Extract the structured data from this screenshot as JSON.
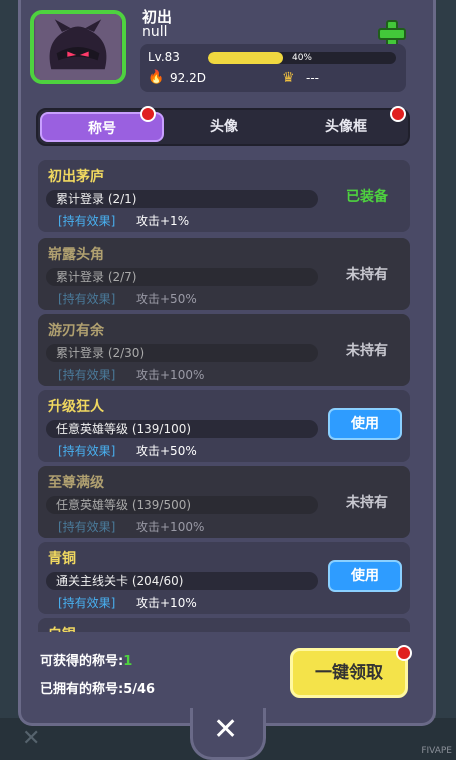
{
  "profile": {
    "name": "初出",
    "uid": "null",
    "level": "Lv.83",
    "exp_percent": 0.4,
    "exp_text": "40%",
    "power": "92.2D",
    "crown_value": "---"
  },
  "tabs": [
    {
      "label": "称号",
      "active": true,
      "badge": true
    },
    {
      "label": "头像",
      "active": false,
      "badge": false
    },
    {
      "label": "头像框",
      "active": false,
      "badge": true
    }
  ],
  "effect_label": "[持有效果]",
  "titles": [
    {
      "title": "初出茅庐",
      "requirement": "累计登录 (2/1)",
      "effect": "攻击+1%",
      "status": "已装备",
      "state": "equipped"
    },
    {
      "title": "崭露头角",
      "requirement": "累计登录 (2/7)",
      "effect": "攻击+50%",
      "status": "未持有",
      "state": "unowned"
    },
    {
      "title": "游刃有余",
      "requirement": "累计登录 (2/30)",
      "effect": "攻击+100%",
      "status": "未持有",
      "state": "unowned"
    },
    {
      "title": "升级狂人",
      "requirement": "任意英雄等级 (139/100)",
      "effect": "攻击+50%",
      "status": "使用",
      "state": "usable"
    },
    {
      "title": "至尊满级",
      "requirement": "任意英雄等级 (139/500)",
      "effect": "攻击+100%",
      "status": "未持有",
      "state": "unowned"
    },
    {
      "title": "青铜",
      "requirement": "通关主线关卡 (204/60)",
      "effect": "攻击+10%",
      "status": "使用",
      "state": "usable"
    },
    {
      "title": "白银",
      "requirement": "",
      "effect": "",
      "status": "",
      "state": "partial"
    }
  ],
  "footer": {
    "available_label": "可获得的称号:",
    "available_count": "1",
    "owned_label": "已拥有的称号:",
    "owned_count": "5/46",
    "claim_all": "一键领取"
  },
  "close_symbol": "✕",
  "watermark": "FIVAPE"
}
